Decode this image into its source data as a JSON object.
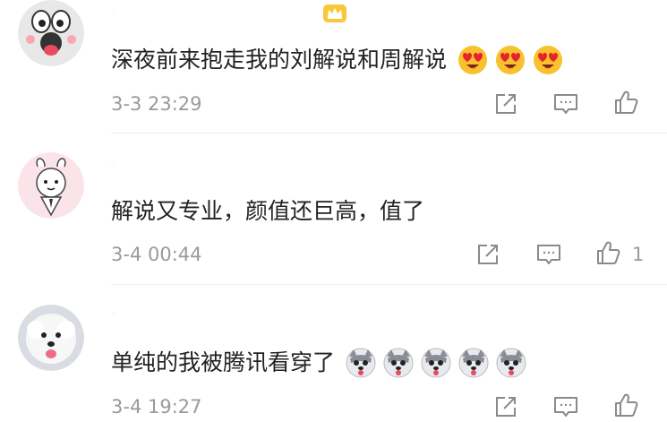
{
  "comments": [
    {
      "username": "·",
      "content": "深夜前来抱走我的刘解说和周解说",
      "emoji": [
        "heart-eyes-emoji",
        "heart-eyes-emoji",
        "heart-eyes-emoji"
      ],
      "time": "3-3 23:29",
      "likes": ""
    },
    {
      "username": "·",
      "content": "解说又专业，颜值还巨高，值了",
      "emoji": [],
      "time": "3-4 00:44",
      "likes": "1"
    },
    {
      "username": "·",
      "content": "单纯的我被腾讯看穿了",
      "emoji": [
        "husky-emoji",
        "husky-emoji",
        "husky-emoji",
        "husky-emoji",
        "husky-emoji"
      ],
      "time": "3-4 19:27",
      "likes": ""
    }
  ],
  "colors": {
    "text": "#222222",
    "meta": "#9a9a9a",
    "divider": "#ececec",
    "icon": "#8a8a8a"
  }
}
